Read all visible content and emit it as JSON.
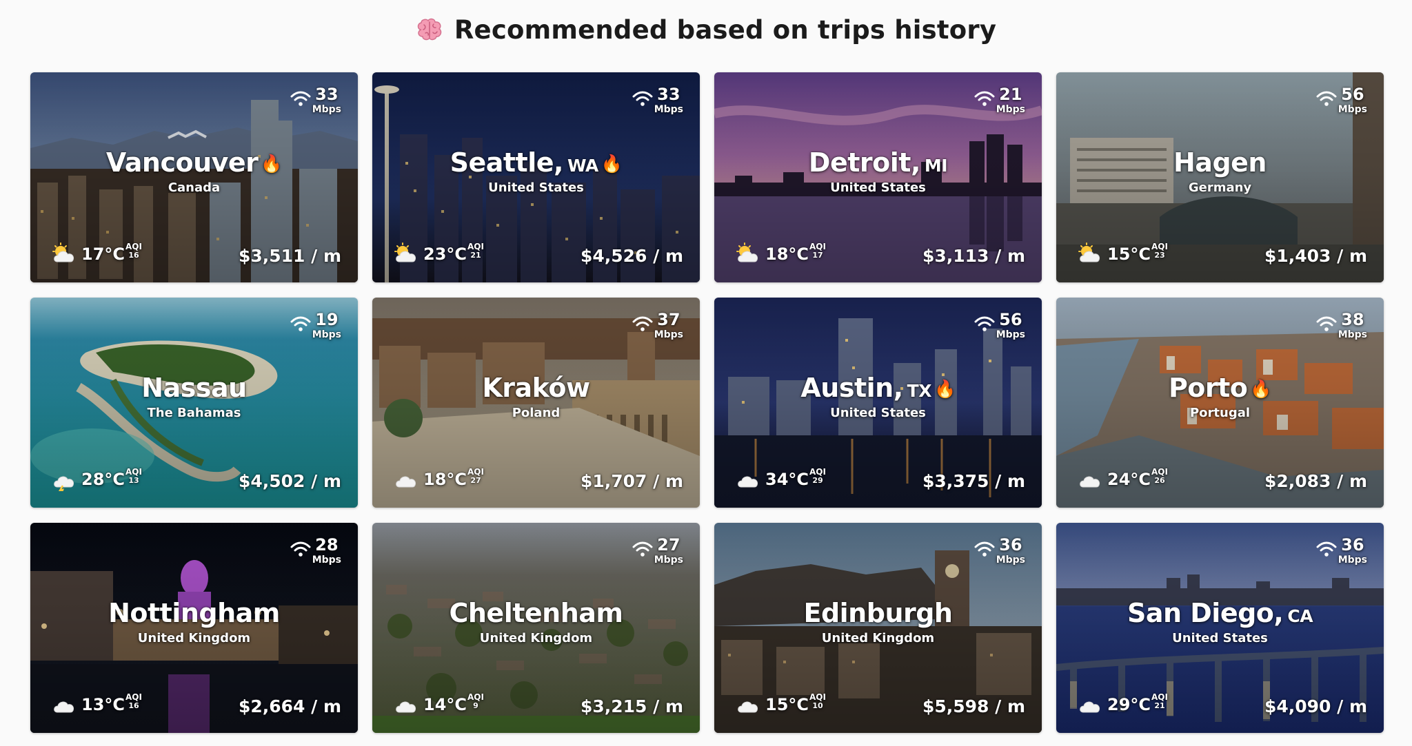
{
  "title": "Recommended based on trips history",
  "cards": [
    {
      "city": "Vancouver",
      "state": "",
      "country": "Canada",
      "hot": true,
      "mbps": "33",
      "mbps_unit": "Mbps",
      "temp": "17°C",
      "aqi_label": "AQI",
      "aqi": "16",
      "price": "$3,511 / m",
      "weather": "sun-cloud"
    },
    {
      "city": "Seattle,",
      "state": "WA",
      "country": "United States",
      "hot": true,
      "mbps": "33",
      "mbps_unit": "Mbps",
      "temp": "23°C",
      "aqi_label": "AQI",
      "aqi": "21",
      "price": "$4,526 / m",
      "weather": "sun-cloud"
    },
    {
      "city": "Detroit,",
      "state": "MI",
      "country": "United States",
      "hot": false,
      "mbps": "21",
      "mbps_unit": "Mbps",
      "temp": "18°C",
      "aqi_label": "AQI",
      "aqi": "17",
      "price": "$3,113 / m",
      "weather": "sun-cloud"
    },
    {
      "city": "Hagen",
      "state": "",
      "country": "Germany",
      "hot": false,
      "mbps": "56",
      "mbps_unit": "Mbps",
      "temp": "15°C",
      "aqi_label": "AQI",
      "aqi": "23",
      "price": "$1,403 / m",
      "weather": "sun-cloud"
    },
    {
      "city": "Nassau",
      "state": "",
      "country": "The Bahamas",
      "hot": false,
      "mbps": "19",
      "mbps_unit": "Mbps",
      "temp": "28°C",
      "aqi_label": "AQI",
      "aqi": "13",
      "price": "$4,502 / m",
      "weather": "storm-cloud"
    },
    {
      "city": "Kraków",
      "state": "",
      "country": "Poland",
      "hot": false,
      "mbps": "37",
      "mbps_unit": "Mbps",
      "temp": "18°C",
      "aqi_label": "AQI",
      "aqi": "27",
      "price": "$1,707 / m",
      "weather": "cloud"
    },
    {
      "city": "Austin,",
      "state": "TX",
      "country": "United States",
      "hot": true,
      "mbps": "56",
      "mbps_unit": "Mbps",
      "temp": "34°C",
      "aqi_label": "AQI",
      "aqi": "29",
      "price": "$3,375 / m",
      "weather": "cloud"
    },
    {
      "city": "Porto",
      "state": "",
      "country": "Portugal",
      "hot": true,
      "mbps": "38",
      "mbps_unit": "Mbps",
      "temp": "24°C",
      "aqi_label": "AQI",
      "aqi": "26",
      "price": "$2,083 / m",
      "weather": "cloud"
    },
    {
      "city": "Nottingham",
      "state": "",
      "country": "United Kingdom",
      "hot": false,
      "mbps": "28",
      "mbps_unit": "Mbps",
      "temp": "13°C",
      "aqi_label": "AQI",
      "aqi": "16",
      "price": "$2,664 / m",
      "weather": "cloud"
    },
    {
      "city": "Cheltenham",
      "state": "",
      "country": "United Kingdom",
      "hot": false,
      "mbps": "27",
      "mbps_unit": "Mbps",
      "temp": "14°C",
      "aqi_label": "AQI",
      "aqi": "9",
      "price": "$3,215 / m",
      "weather": "cloud"
    },
    {
      "city": "Edinburgh",
      "state": "",
      "country": "United Kingdom",
      "hot": false,
      "mbps": "36",
      "mbps_unit": "Mbps",
      "temp": "15°C",
      "aqi_label": "AQI",
      "aqi": "10",
      "price": "$5,598 / m",
      "weather": "cloud"
    },
    {
      "city": "San Diego,",
      "state": "CA",
      "country": "United States",
      "hot": false,
      "mbps": "36",
      "mbps_unit": "Mbps",
      "temp": "29°C",
      "aqi_label": "AQI",
      "aqi": "21",
      "price": "$4,090 / m",
      "weather": "cloud"
    }
  ],
  "flame_glyph": "🔥",
  "colors": {
    "accent_flame": "#ff7a1a",
    "card_text": "#ffffff",
    "title_text": "#1b1b1b"
  }
}
